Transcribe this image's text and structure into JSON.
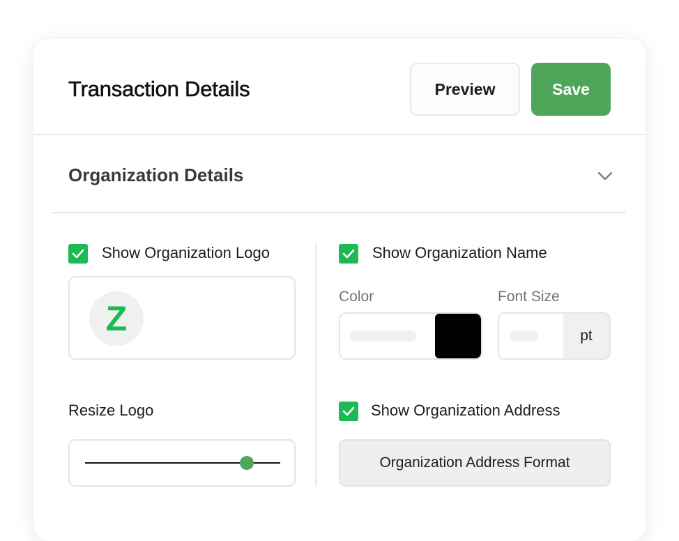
{
  "header": {
    "title": "Transaction Details",
    "preview_label": "Preview",
    "save_label": "Save"
  },
  "section": {
    "title": "Organization Details"
  },
  "logo": {
    "show_label": "Show Organization Logo",
    "checked": true,
    "logo_letter": "Z",
    "resize_label": "Resize Logo",
    "resize_value": 0.83
  },
  "name": {
    "show_label": "Show Organization Name",
    "checked": true,
    "color_label": "Color",
    "color_value": "#000000",
    "font_size_label": "Font Size",
    "font_size_unit": "pt"
  },
  "address": {
    "show_label": "Show Organization Address",
    "checked": true,
    "format_button_label": "Organization Address Format"
  },
  "colors": {
    "accent": "#4fa65a",
    "checkbox": "#1db954"
  }
}
